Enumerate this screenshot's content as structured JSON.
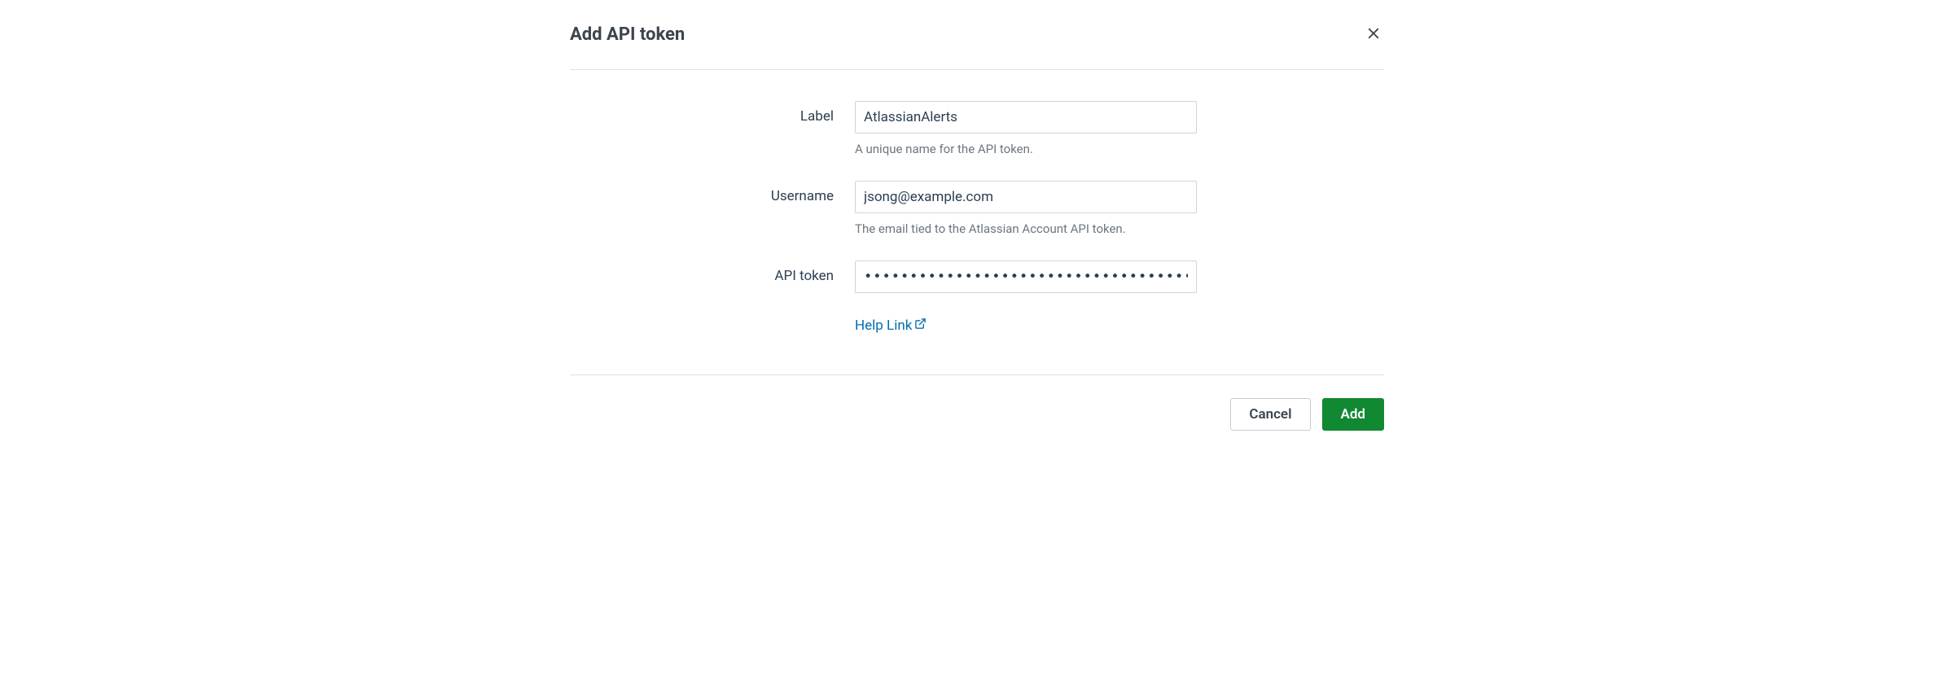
{
  "dialog": {
    "title": "Add API token",
    "labelField": {
      "label": "Label",
      "value": "AtlassianAlerts",
      "help": "A unique name for the API token."
    },
    "usernameField": {
      "label": "Username",
      "value": "jsong@example.com",
      "help": "The email tied to the Atlassian Account API token."
    },
    "apiTokenField": {
      "label": "API token",
      "value": "••••••••••••••••••••••••••••••••••••••••••••••••••••••••••••••••"
    },
    "helpLink": {
      "text": "Help Link"
    },
    "buttons": {
      "cancel": "Cancel",
      "add": "Add"
    }
  }
}
